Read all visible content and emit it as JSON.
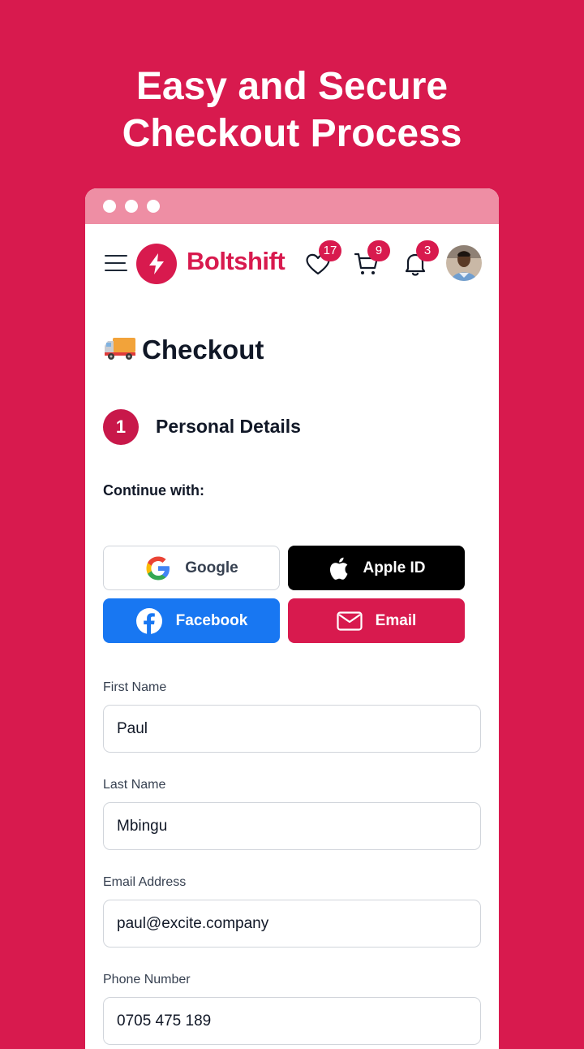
{
  "hero": {
    "line1": "Easy and Secure",
    "line2": "Checkout Process"
  },
  "colors": {
    "brand": "#d81a4e",
    "titlebar": "#ee8ea4",
    "facebook": "#1877f2",
    "apple": "#000000"
  },
  "navbar": {
    "brand_name": "Boltshift",
    "wishlist_count": "17",
    "cart_count": "9",
    "notifications_count": "3",
    "icons": [
      "menu-icon",
      "bolt-logo-icon",
      "heart-icon",
      "cart-icon",
      "bell-icon",
      "avatar"
    ]
  },
  "page": {
    "title": "Checkout",
    "step_number": "1",
    "step_label": "Personal Details",
    "continue_with": "Continue with:"
  },
  "social": {
    "google": "Google",
    "apple": "Apple ID",
    "facebook": "Facebook",
    "email": "Email"
  },
  "form": {
    "first_name_label": "First Name",
    "first_name_value": "Paul",
    "last_name_label": "Last Name",
    "last_name_value": "Mbingu",
    "email_label": "Email Address",
    "email_value": "paul@excite.company",
    "phone_label": "Phone Number",
    "phone_value": "0705 475 189"
  }
}
